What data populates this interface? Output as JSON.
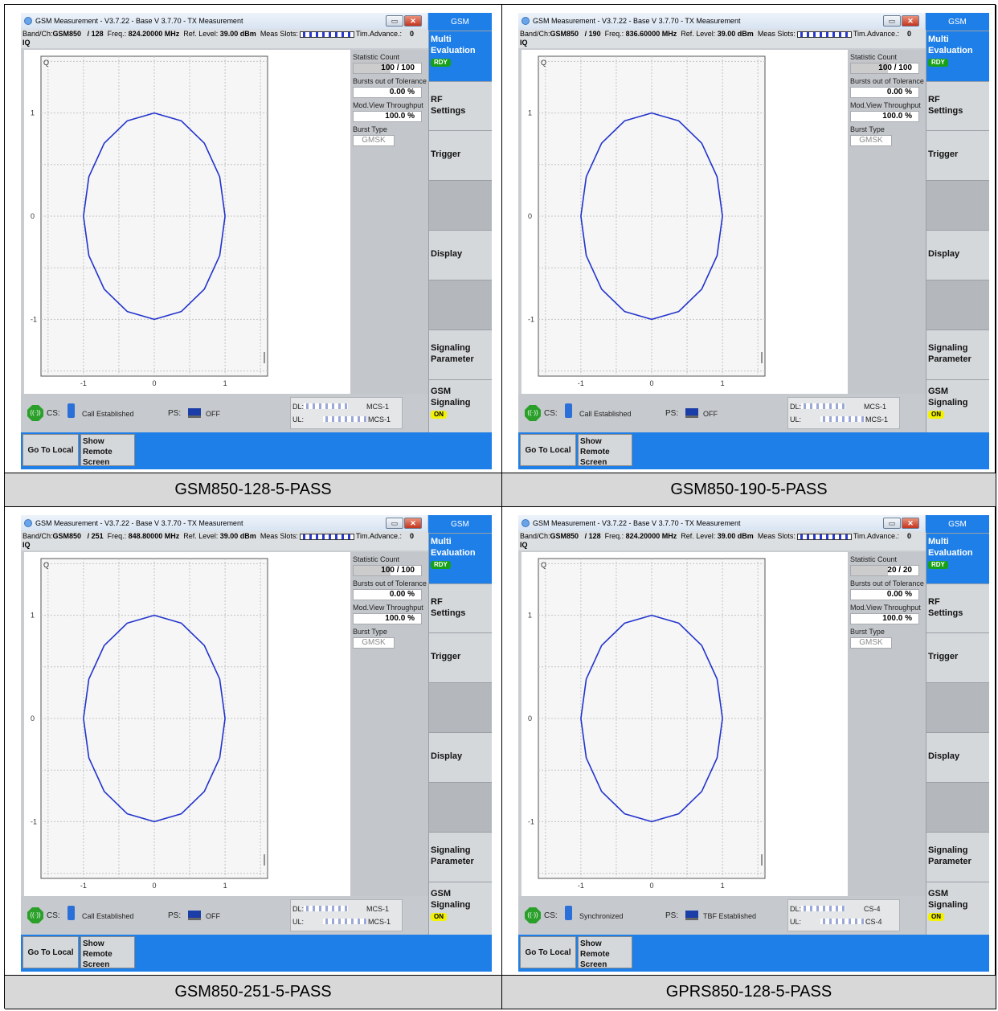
{
  "panels": [
    {
      "caption": "GSM850-128-5-PASS",
      "window_title": "GSM Measurement  - V3.7.22 - Base V 3.7.70 - TX Measurement",
      "band": "GSM850",
      "channel": "/ 128",
      "freq_label": "Freq.:",
      "freq": "824.20000 MHz",
      "ref_label": "Ref. Level:",
      "ref": "39.00 dBm",
      "meas_slots": "Meas Slots:",
      "tim_adv_label": "Tim.Advance.:",
      "tim_adv": "0",
      "stat_count": "100 / 100",
      "bursts_oot": "0.00  %",
      "throughput": "100.0  %",
      "burst_type": "GMSK",
      "cs_status": "Call Established",
      "ps_status": "OFF",
      "dl_coding": "MCS-1",
      "ul_coding": "MCS-1"
    },
    {
      "caption": "GSM850-190-5-PASS",
      "window_title": "GSM Measurement  - V3.7.22 - Base V 3.7.70 - TX Measurement",
      "band": "GSM850",
      "channel": "/ 190",
      "freq_label": "Freq.:",
      "freq": "836.60000 MHz",
      "ref_label": "Ref. Level:",
      "ref": "39.00 dBm",
      "meas_slots": "Meas Slots:",
      "tim_adv_label": "Tim.Advance.:",
      "tim_adv": "0",
      "stat_count": "100 / 100",
      "bursts_oot": "0.00  %",
      "throughput": "100.0  %",
      "burst_type": "GMSK",
      "cs_status": "Call Established",
      "ps_status": "OFF",
      "dl_coding": "MCS-1",
      "ul_coding": "MCS-1"
    },
    {
      "caption": "GSM850-251-5-PASS",
      "window_title": "GSM Measurement  - V3.7.22 - Base V 3.7.70 - TX Measurement",
      "band": "GSM850",
      "channel": "/ 251",
      "freq_label": "Freq.:",
      "freq": "848.80000 MHz",
      "ref_label": "Ref. Level:",
      "ref": "39.00 dBm",
      "meas_slots": "Meas Slots:",
      "tim_adv_label": "Tim.Advance.:",
      "tim_adv": "0",
      "stat_count": "100 / 100",
      "bursts_oot": "0.00  %",
      "throughput": "100.0  %",
      "burst_type": "GMSK",
      "cs_status": "Call Established",
      "ps_status": "OFF",
      "dl_coding": "MCS-1",
      "ul_coding": "MCS-1"
    },
    {
      "caption": "GPRS850-128-5-PASS",
      "window_title": "GSM Measurement  - V3.7.22 - Base V 3.7.70 - TX Measurement",
      "band": "GSM850",
      "channel": "/ 128",
      "freq_label": "Freq.:",
      "freq": "824.20000 MHz",
      "ref_label": "Ref. Level:",
      "ref": "39.00 dBm",
      "meas_slots": "Meas Slots:",
      "tim_adv_label": "Tim.Advance.:",
      "tim_adv": "0",
      "stat_count": "20 / 20",
      "bursts_oot": "0.00  %",
      "throughput": "100.0  %",
      "burst_type": "GMSK",
      "cs_status": "Synchronized",
      "ps_status": "TBF Established",
      "dl_coding": "CS-4",
      "ul_coding": "CS-4"
    }
  ],
  "common": {
    "band_label": "Band/Ch:",
    "iq": "IQ",
    "q": "Q",
    "stat_label": "Statistic Count",
    "bursts_label": "Bursts out of Tolerance",
    "throughput_label": "Mod.View Throughput",
    "burst_type_label": "Burst Type",
    "gsm": "GSM",
    "multi": "Multi",
    "evaluation": "Evaluation",
    "rdy": "RDY",
    "rf": "RF",
    "settings": "Settings",
    "trigger": "Trigger",
    "display": "Display",
    "signaling": "Signaling",
    "parameter": "Parameter",
    "gsm_sig": "GSM",
    "sig2": "Signaling",
    "on": "ON",
    "cs": "CS:",
    "ps": "PS:",
    "dl": "DL:",
    "ul": "UL:",
    "go_local": "Go To Local",
    "show_remote": "Show Remote",
    "screen": "Screen",
    "min_glyph": "▭",
    "close_glyph": "✕",
    "y_ticks": [
      "1",
      "0",
      "-1"
    ],
    "x_ticks": [
      "-1",
      "0",
      "1"
    ]
  },
  "colors": {
    "accent": "#1f7fe8",
    "trace": "#2233cc",
    "rdy": "#18a018",
    "on": "#f2f200"
  },
  "iq_plot": {
    "type": "scatter",
    "shape": "constellation ring",
    "radius": 1.0,
    "x_range": [
      -1.6,
      1.6
    ],
    "y_range": [
      -1.55,
      1.55
    ]
  }
}
